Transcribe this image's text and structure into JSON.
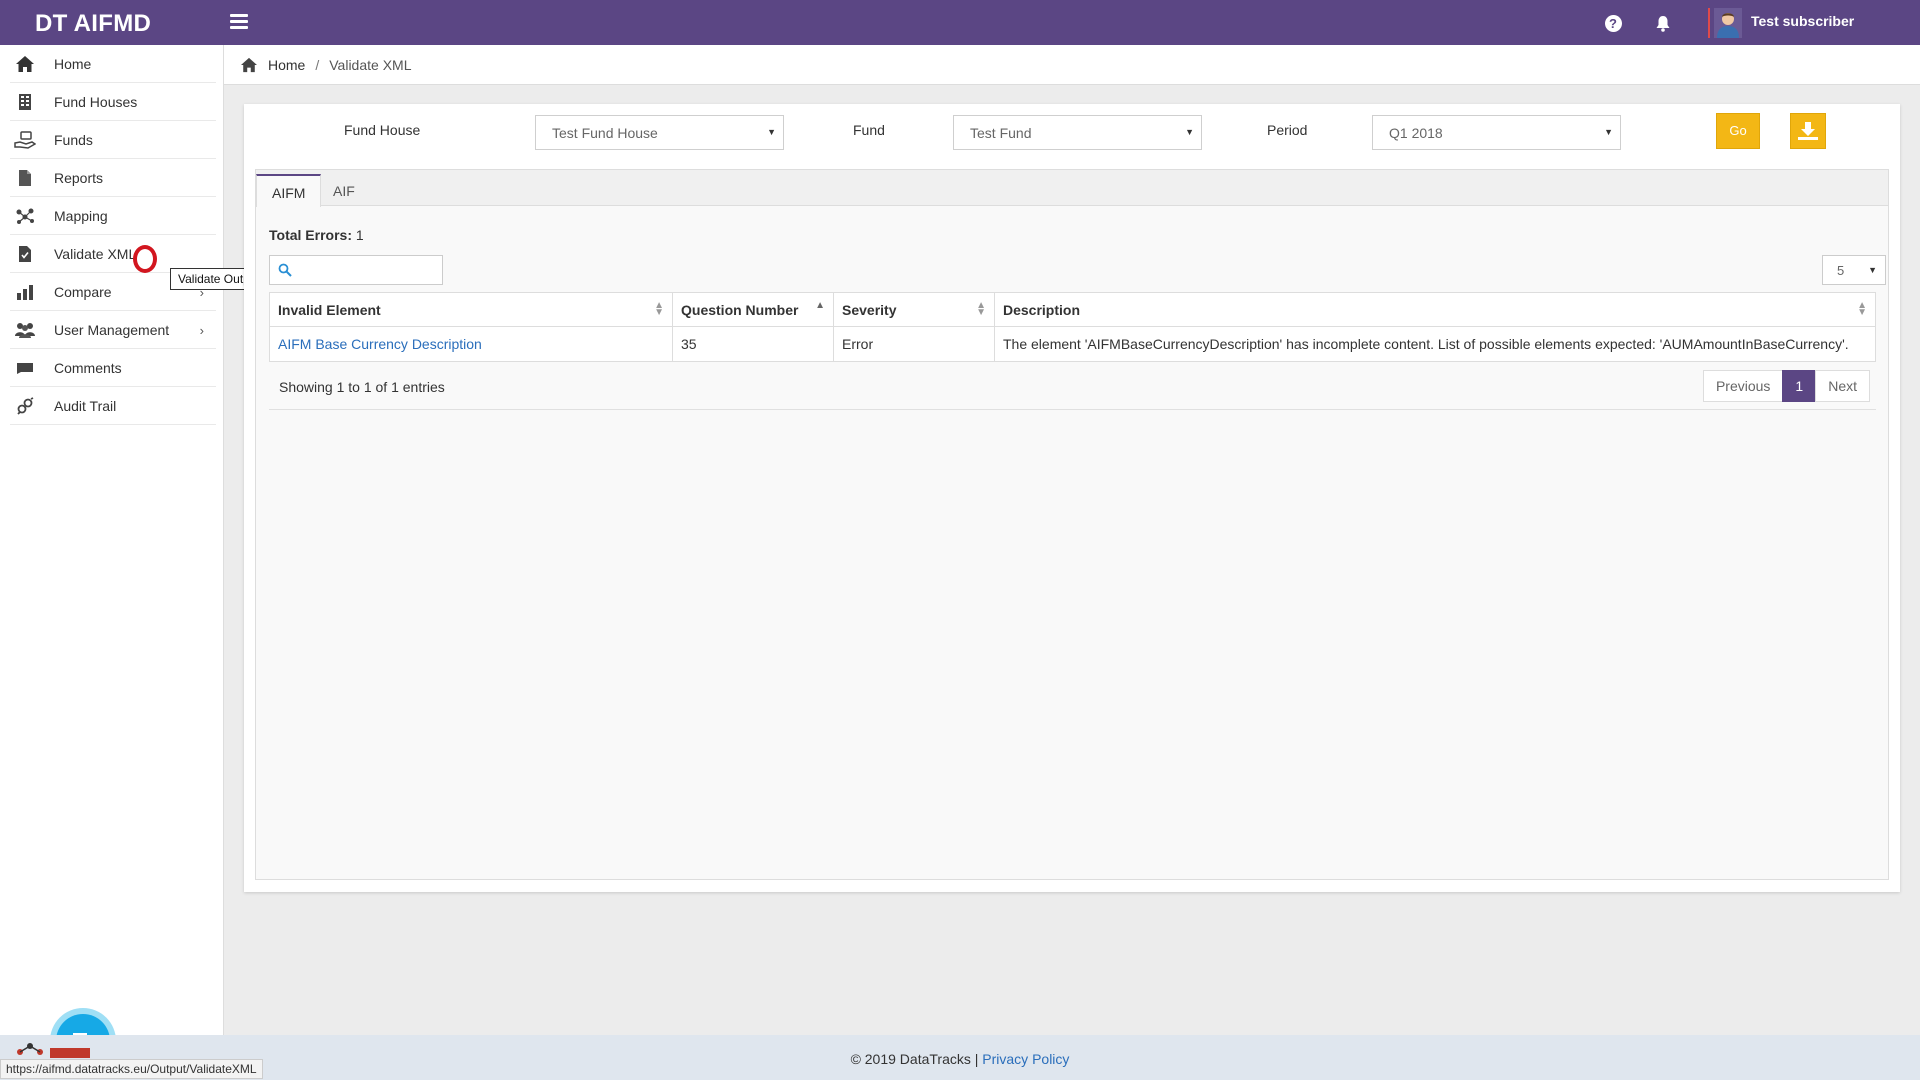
{
  "app": {
    "title": "DT AIFMD"
  },
  "header": {
    "username": "Test subscriber"
  },
  "sidebar": {
    "items": [
      {
        "label": "Home",
        "icon": "home-icon"
      },
      {
        "label": "Fund Houses",
        "icon": "building-icon"
      },
      {
        "label": "Funds",
        "icon": "money-hand-icon"
      },
      {
        "label": "Reports",
        "icon": "document-icon"
      },
      {
        "label": "Mapping",
        "icon": "network-icon"
      },
      {
        "label": "Validate XML",
        "icon": "file-check-icon"
      },
      {
        "label": "Compare",
        "icon": "bar-chart-icon",
        "has_submenu": true
      },
      {
        "label": "User Management",
        "icon": "users-icon",
        "has_submenu": true
      },
      {
        "label": "Comments",
        "icon": "comment-icon"
      },
      {
        "label": "Audit Trail",
        "icon": "audit-icon"
      }
    ],
    "tooltip": "Validate Output"
  },
  "breadcrumb": {
    "home": "Home",
    "separator": "/",
    "current": "Validate XML"
  },
  "filters": {
    "fund_house_label": "Fund House",
    "fund_house_value": "Test Fund House",
    "fund_label": "Fund",
    "fund_value": "Test Fund",
    "period_label": "Period",
    "period_value": "Q1 2018",
    "go_label": "Go"
  },
  "tabs": [
    {
      "label": "AIFM",
      "active": true
    },
    {
      "label": "AIF",
      "active": false
    }
  ],
  "results": {
    "total_errors_label": "Total Errors:",
    "total_errors_value": "1",
    "search_value": "",
    "page_size": "5",
    "columns": [
      "Invalid Element",
      "Question Number",
      "Severity",
      "Description"
    ],
    "rows": [
      {
        "invalid_element": "AIFM Base Currency Description",
        "question_number": "35",
        "severity": "Error",
        "description": "The element 'AIFMBaseCurrencyDescription' has incomplete content. List of possible elements expected: 'AUMAmountInBaseCurrency'."
      }
    ],
    "showing_text": "Showing 1 to 1 of 1 entries",
    "pager": {
      "previous": "Previous",
      "current": "1",
      "next": "Next"
    }
  },
  "footer": {
    "copyright": "© 2019 DataTracks |",
    "privacy": "Privacy Policy"
  },
  "status_bar": {
    "url": "https://aifmd.datatracks.eu/Output/ValidateXML"
  },
  "colors": {
    "brand": "#5b4684",
    "accent": "#f3b715",
    "link": "#2a6ebb",
    "chat": "#16a9e6"
  }
}
